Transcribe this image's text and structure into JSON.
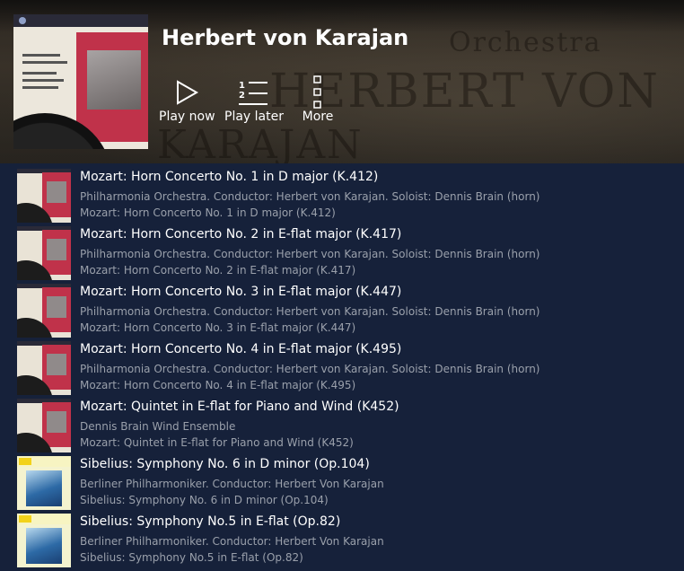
{
  "artist": {
    "name": "Herbert von Karajan",
    "background_words": [
      "Orchestra",
      "HERBERT VON",
      "KARAJAN"
    ]
  },
  "actions": [
    {
      "label": "Play now",
      "icon": "play-icon"
    },
    {
      "label": "Play later",
      "icon": "queue-icon"
    },
    {
      "label": "More",
      "icon": "more-icon"
    }
  ],
  "tracks": [
    {
      "title": "Mozart: Horn Concerto No. 1 in D major (K.412)",
      "artists": "Philharmonia Orchestra. Conductor: Herbert von Karajan. Soloist: Dennis Brain (horn)",
      "album": "Mozart: Horn Concerto No. 1 in D major (K.412)",
      "cover": "mozart-cover"
    },
    {
      "title": "Mozart: Horn Concerto No. 2 in E-flat major (K.417)",
      "artists": "Philharmonia Orchestra. Conductor: Herbert von Karajan. Soloist: Dennis Brain (horn)",
      "album": "Mozart: Horn Concerto No. 2 in E-flat major (K.417)",
      "cover": "mozart-cover"
    },
    {
      "title": "Mozart: Horn Concerto No. 3 in E-flat major (K.447)",
      "artists": "Philharmonia Orchestra. Conductor: Herbert von Karajan. Soloist: Dennis Brain (horn)",
      "album": "Mozart: Horn Concerto No. 3 in E-flat major (K.447)",
      "cover": "mozart-cover"
    },
    {
      "title": "Mozart: Horn Concerto No. 4 in E-flat major (K.495)",
      "artists": "Philharmonia Orchestra. Conductor: Herbert von Karajan. Soloist: Dennis Brain (horn)",
      "album": "Mozart: Horn Concerto No. 4 in E-flat major (K.495)",
      "cover": "mozart-cover"
    },
    {
      "title": "Mozart: Quintet in E-flat for Piano and Wind (K452)",
      "artists": "Dennis Brain Wind Ensemble",
      "album": "Mozart: Quintet in E-flat for Piano and Wind (K452)",
      "cover": "mozart-cover"
    },
    {
      "title": "Sibelius: Symphony No. 6 in D minor (Op.104)",
      "artists": "Berliner Philharmoniker. Conductor: Herbert Von Karajan",
      "album": "Sibelius: Symphony No. 6 in D minor (Op.104)",
      "cover": "sibelius-cover"
    },
    {
      "title": "Sibelius: Symphony No.5 in E-flat (Op.82)",
      "artists": "Berliner Philharmoniker. Conductor: Herbert Von Karajan",
      "album": "Sibelius: Symphony No.5 in E-flat (Op.82)",
      "cover": "sibelius-cover"
    }
  ],
  "colors": {
    "list_background": "#16213a",
    "secondary_text": "#9aa0ab",
    "cover_red": "#c0324a"
  }
}
